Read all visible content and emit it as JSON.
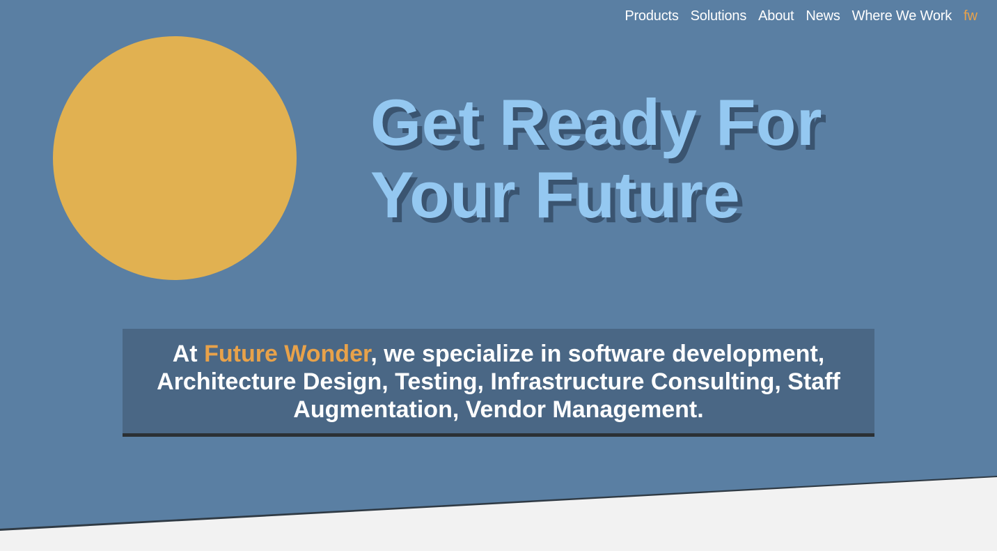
{
  "nav": {
    "items": [
      {
        "label": "Products"
      },
      {
        "label": "Solutions"
      },
      {
        "label": "About"
      },
      {
        "label": "News"
      },
      {
        "label": "Where We Work"
      }
    ],
    "logo": "fw"
  },
  "hero": {
    "headline": "Get Ready For Your Future"
  },
  "tagline": {
    "prefix": "At ",
    "brand": "Future Wonder",
    "suffix": ", we specialize in software development, Architecture Design, Testing, Infrastructure Consulting, Staff Augmentation, Vendor Management."
  },
  "colors": {
    "hero_background": "#5a7fa3",
    "sun": "#e1b151",
    "headline": "#94c8f1",
    "accent": "#e8a24a",
    "tagline_box": "#4a6785",
    "page_background": "#f2f2f2"
  }
}
